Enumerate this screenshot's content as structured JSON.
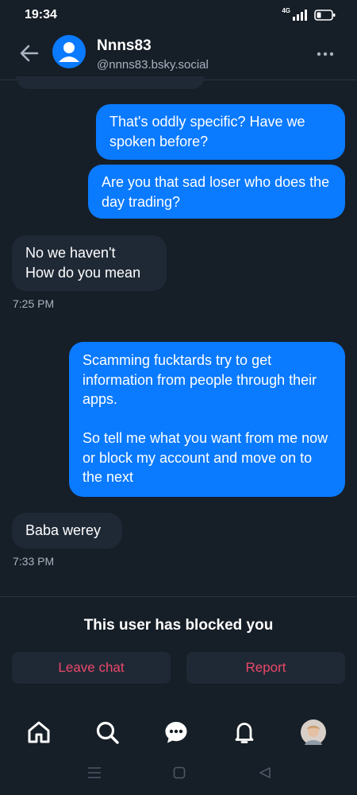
{
  "status_bar": {
    "time": "19:34",
    "signal_label": "4G"
  },
  "header": {
    "name": "Nnns83",
    "handle": "@nnns83.bsky.social"
  },
  "messages": [
    {
      "from": "me",
      "text": "That's oddly specific? Have we spoken before?"
    },
    {
      "from": "me",
      "text": "Are you that sad loser who does the day trading?"
    },
    {
      "from": "them",
      "text": "No we haven't\nHow do you mean",
      "time": "7:25 PM"
    },
    {
      "from": "me",
      "text": "Scamming fucktards try to get information from people through their apps.\n\nSo tell me what you want from me now or block my account and move on to the next"
    },
    {
      "from": "them",
      "text": "Baba werey",
      "time": "7:33 PM"
    }
  ],
  "blocked": {
    "text": "This user has blocked you",
    "leave_label": "Leave chat",
    "report_label": "Report"
  },
  "tabs": [
    "home-icon",
    "search-icon",
    "chat-icon",
    "bell-icon",
    "profile-avatar"
  ],
  "colors": {
    "accent": "#0a7aff",
    "danger": "#ec4868",
    "background": "#161e27",
    "bubble_theirs": "#1f2936"
  }
}
